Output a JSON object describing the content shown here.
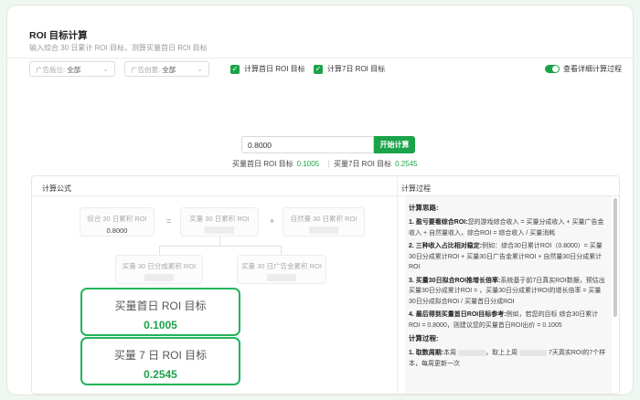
{
  "header": {
    "title": "ROI 目标计算",
    "subtitle": "输入综合 30 日累计 ROI 目标，测算买量首日 ROI 目标"
  },
  "filters": {
    "ad_slot": {
      "label": "广告版位:",
      "value": "全部"
    },
    "ad_creative": {
      "label": "广告创意:",
      "value": "全部"
    },
    "calc_day1": {
      "label": "计算首日 ROI 目标",
      "checked": true
    },
    "calc_day7": {
      "label": "计算7日 ROI 目标",
      "checked": true
    },
    "detail_toggle": {
      "label": "查看详细计算过程",
      "on": true
    }
  },
  "calc": {
    "input_value": "0.8000",
    "start_label": "开始计算",
    "day1_label": "买量首日 ROI 目标",
    "day1_value": "0.1005",
    "day7_label": "买量7日 ROI 目标",
    "day7_value": "0.2545"
  },
  "formula": {
    "title": "计算公式",
    "node_total": {
      "label": "综合 30 日累积 ROI",
      "value": "0.8000"
    },
    "op_equals": "=",
    "node_paid": {
      "label": "买量 30 日累积 ROI"
    },
    "op_plus": "+",
    "node_natural": {
      "label": "自然量 30 日累积 ROI"
    },
    "node_share": {
      "label": "买量 30 日分成累积 ROI"
    },
    "node_adrev": {
      "label": "买量 30 日广告金累积 ROI"
    }
  },
  "cards": {
    "day1": {
      "title": "买量首日 ROI 目标",
      "value": "0.1005"
    },
    "day7": {
      "title": "买量 7 日 ROI 目标",
      "value": "0.2545"
    }
  },
  "process": {
    "title": "计算过程",
    "idea_title": "计算思路:",
    "steps": [
      {
        "head": "1. 盈亏要看综合ROI:",
        "text": "您的游戏综合收入 = 买量分成收入 + 买量广告金收入 + 自然量收入，综合ROI = 综合收入 / 买量消耗"
      },
      {
        "head": "2. 三种收入占比相对稳定:",
        "text": "例如：综合30日累计ROI（0.8000）= 买量30日分成累计ROI + 买量30日广告金累计ROI + 自然量30日分成累计ROI"
      },
      {
        "head": "3. 买量30日拟合ROI推增长倍率:",
        "text": "系统基于前7日真实ROI数据，预估出买量30日分成累计ROI = ，买量30日分成累计ROI的增长倍率 = 买量30日分成拟合ROI / 买量首日分成ROI"
      },
      {
        "head": "4. 最后得到买量首日ROI目标参考:",
        "text": "例如，若您的目标 综合30日累计ROI = 0.8000，则建议您的买量首日ROI出价 = 0.1005"
      }
    ],
    "calc_title": "计算过程:",
    "calc_step_head": "1. 取数周期:",
    "calc_step_text1": "本周",
    "calc_step_text2": "，取上上周",
    "calc_step_text3": "7天真实ROI的7个样本，每周更新一次"
  }
}
